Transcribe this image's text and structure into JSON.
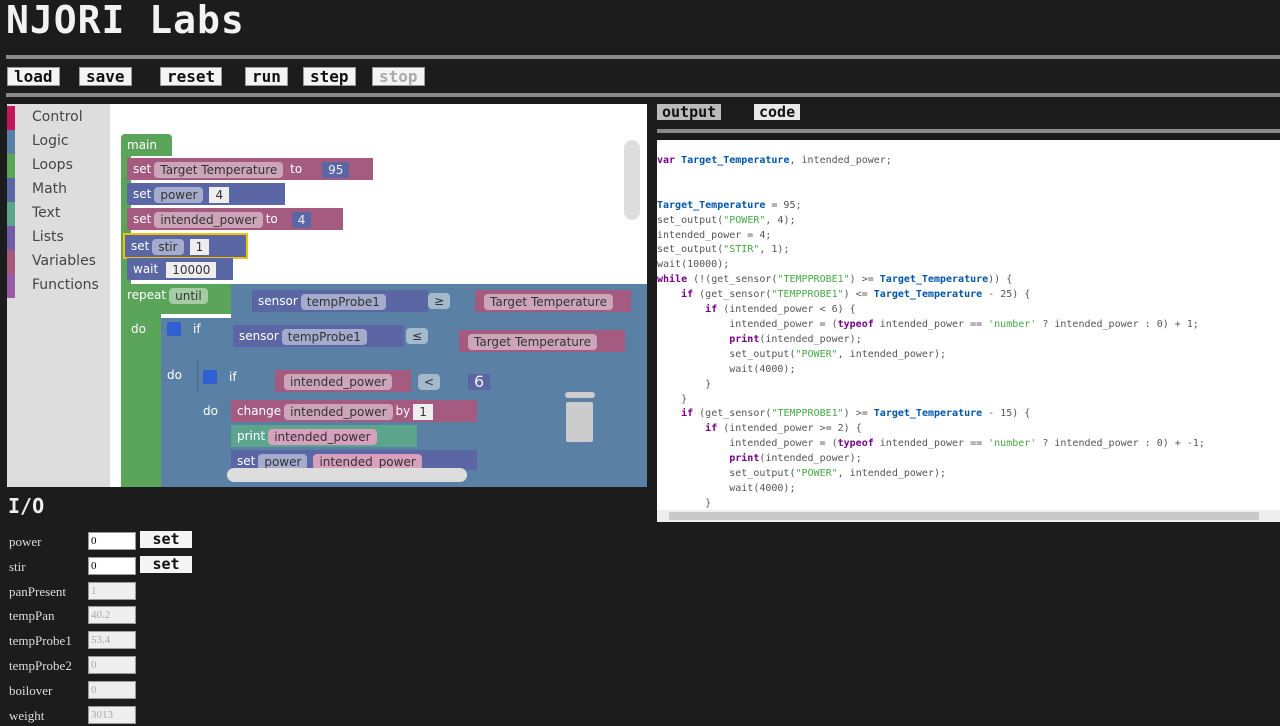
{
  "app": {
    "title": "NJORI Labs"
  },
  "toolbar": {
    "load": "load",
    "save": "save",
    "reset": "reset",
    "run": "run",
    "step": "step",
    "stop": "stop"
  },
  "toolbox": {
    "categories": [
      {
        "label": "Control",
        "color": "#c2185b"
      },
      {
        "label": "Logic",
        "color": "#5b80a5"
      },
      {
        "label": "Loops",
        "color": "#5ba55b"
      },
      {
        "label": "Math",
        "color": "#5b67a5"
      },
      {
        "label": "Text",
        "color": "#5ba58c"
      },
      {
        "label": "Lists",
        "color": "#745ba5"
      },
      {
        "label": "Variables",
        "color": "#a55b80"
      },
      {
        "label": "Functions",
        "color": "#995ba5"
      }
    ]
  },
  "blocks": {
    "main": "main",
    "set": "set",
    "to": "to",
    "wait": "wait",
    "repeat": "repeat",
    "until": "until",
    "do": "do",
    "if": "if",
    "sensor": "sensor",
    "change": "change",
    "by": "by",
    "print": "print",
    "var_target": "Target Temperature",
    "val_target": "95",
    "var_power": "power",
    "val_power": "4",
    "var_intended": "intended_power",
    "val_intended": "4",
    "var_stir": "stir",
    "val_stir": "1",
    "val_wait": "10000",
    "probe": "tempProbe1",
    "op_ge": "≥",
    "op_le": "≤",
    "op_lt": "<",
    "val_six": "6",
    "val_one": "1"
  },
  "right": {
    "tabs": [
      "output",
      "code"
    ],
    "active_tab": "output"
  },
  "code_lines": [
    "var Target_Temperature, intended_power;",
    "",
    "",
    "Target_Temperature = 95;",
    "set_output(\"POWER\", 4);",
    "intended_power = 4;",
    "set_output(\"STIR\", 1);",
    "wait(10000);",
    "while (!(get_sensor(\"TEMPPROBE1\") >= Target_Temperature)) {",
    "    if (get_sensor(\"TEMPPROBE1\") <= Target_Temperature - 25) {",
    "        if (intended_power < 6) {",
    "            intended_power = (typeof intended_power == 'number' ? intended_power : 0) + 1;",
    "            print(intended_power);",
    "            set_output(\"POWER\", intended_power);",
    "            wait(4000);",
    "        }",
    "    }",
    "    if (get_sensor(\"TEMPPROBE1\") >= Target_Temperature - 15) {",
    "        if (intended_power >= 2) {",
    "            intended_power = (typeof intended_power == 'number' ? intended_power : 0) + -1;",
    "            print(intended_power);",
    "            set_output(\"POWER\", intended_power);",
    "            wait(4000);",
    "        }"
  ],
  "io": {
    "title": "I/O",
    "set_label": "set",
    "rows": [
      {
        "name": "power",
        "value": "0",
        "editable": true
      },
      {
        "name": "stir",
        "value": "0",
        "editable": true
      },
      {
        "name": "panPresent",
        "value": "1",
        "editable": false
      },
      {
        "name": "tempPan",
        "value": "40.2",
        "editable": false
      },
      {
        "name": "tempProbe1",
        "value": "53.4",
        "editable": false
      },
      {
        "name": "tempProbe2",
        "value": "0",
        "editable": false
      },
      {
        "name": "boilover",
        "value": "0",
        "editable": false
      },
      {
        "name": "weight",
        "value": "3013",
        "editable": false
      }
    ]
  }
}
